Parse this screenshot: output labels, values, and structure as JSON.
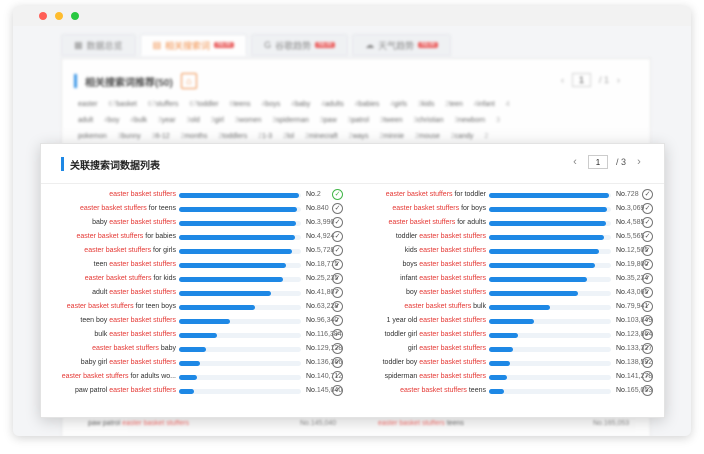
{
  "window": {
    "title": ""
  },
  "background": {
    "tabs": [
      {
        "label": "数据总览",
        "active": false,
        "badge": ""
      },
      {
        "label": "相关搜索词",
        "active": true,
        "badge": "NEW"
      },
      {
        "label": "谷歌趋势",
        "active": false,
        "badge": "NEW"
      },
      {
        "label": "天气趋势",
        "active": false,
        "badge": "NEW"
      }
    ],
    "card_title": "相关搜索词推荐(50)",
    "pager": {
      "page": "1",
      "total": "/ 1"
    },
    "keyword_rows": [
      [
        [
          "easter",
          "67"
        ],
        [
          "basket",
          "67"
        ],
        [
          "stuffers",
          "67"
        ],
        [
          "toddler",
          "6"
        ],
        [
          "teens",
          "4"
        ],
        [
          "boys",
          "4"
        ],
        [
          "baby",
          "4"
        ],
        [
          "adults",
          "4"
        ],
        [
          "babies",
          "4"
        ],
        [
          "girls",
          "3"
        ],
        [
          "kids",
          "2"
        ],
        [
          "teen",
          "4"
        ],
        [
          "infant",
          "4"
        ]
      ],
      [
        [
          "adult",
          "4"
        ],
        [
          "boy",
          "4"
        ],
        [
          "bulk",
          "3"
        ],
        [
          "year",
          "3"
        ],
        [
          "old",
          "3"
        ],
        [
          "girl",
          "3"
        ],
        [
          "women",
          "3"
        ],
        [
          "spiderman",
          "3"
        ],
        [
          "paw",
          "3"
        ],
        [
          "patrol",
          "3"
        ],
        [
          "tween",
          "3"
        ],
        [
          "christian",
          "3"
        ],
        [
          "newborn",
          "3"
        ]
      ],
      [
        [
          "pokemon",
          "3"
        ],
        [
          "bunny",
          "3"
        ],
        [
          "6-12",
          "2"
        ],
        [
          "months",
          "2"
        ],
        [
          "toddlers",
          "2"
        ],
        [
          "1-3",
          "2"
        ],
        [
          "lol",
          "2"
        ],
        [
          "minecraft",
          "2"
        ],
        [
          "ways",
          "2"
        ],
        [
          "minnie",
          "2"
        ],
        [
          "mouse",
          "2"
        ],
        [
          "candy",
          "2"
        ]
      ]
    ]
  },
  "panel": {
    "title": "关联搜索词数据列表",
    "pager": {
      "prev": "‹",
      "page": "1",
      "total": "/ 3",
      "next": "›"
    },
    "left": [
      {
        "pre": "",
        "hl": "easter basket stuffers",
        "post": "",
        "rank": "No.",
        "num": "2",
        "fill": 0.98,
        "checked": true
      },
      {
        "pre": "",
        "hl": "easter basket stuffers",
        "post": " for teens",
        "rank": "No.",
        "num": "840",
        "fill": 0.97,
        "checked": false
      },
      {
        "pre": "baby ",
        "hl": "easter basket stuffers",
        "post": "",
        "rank": "No.",
        "num": "3,990",
        "fill": 0.96,
        "checked": false
      },
      {
        "pre": "",
        "hl": "easter basket stuffers",
        "post": " for babies",
        "rank": "No.",
        "num": "4,924",
        "fill": 0.95,
        "checked": false
      },
      {
        "pre": "",
        "hl": "easter basket stuffers",
        "post": " for girls",
        "rank": "No.",
        "num": "5,728",
        "fill": 0.93,
        "checked": false
      },
      {
        "pre": "teen ",
        "hl": "easter basket stuffers",
        "post": "",
        "rank": "No.",
        "num": "18,775",
        "fill": 0.88,
        "checked": false
      },
      {
        "pre": "",
        "hl": "easter basket stuffers",
        "post": " for kids",
        "rank": "No.",
        "num": "25,235",
        "fill": 0.85,
        "checked": false
      },
      {
        "pre": "adult ",
        "hl": "easter basket stuffers",
        "post": "",
        "rank": "No.",
        "num": "41,807",
        "fill": 0.75,
        "checked": false
      },
      {
        "pre": "",
        "hl": "easter basket stuffers",
        "post": " for teen boys",
        "rank": "No.",
        "num": "63,228",
        "fill": 0.62,
        "checked": false
      },
      {
        "pre": "teen boy ",
        "hl": "easter basket stuffers",
        "post": "",
        "rank": "No.",
        "num": "96,340",
        "fill": 0.42,
        "checked": false
      },
      {
        "pre": "bulk ",
        "hl": "easter basket stuffers",
        "post": "",
        "rank": "No.",
        "num": "116,384",
        "fill": 0.31,
        "checked": false
      },
      {
        "pre": "",
        "hl": "easter basket stuffers",
        "post": " baby",
        "rank": "No.",
        "num": "129,128",
        "fill": 0.22,
        "checked": false
      },
      {
        "pre": "baby girl ",
        "hl": "easter basket stuffers",
        "post": "",
        "rank": "No.",
        "num": "136,366",
        "fill": 0.17,
        "checked": false
      },
      {
        "pre": "",
        "hl": "easter basket stuffers",
        "post": " for adults wo...",
        "rank": "No.",
        "num": "140,712",
        "fill": 0.15,
        "checked": false
      },
      {
        "pre": "paw patrol ",
        "hl": "easter basket stuffers",
        "post": "",
        "rank": "No.",
        "num": "145,040",
        "fill": 0.12,
        "checked": false
      }
    ],
    "right": [
      {
        "pre": "",
        "hl": "easter basket stuffers",
        "post": " for toddler",
        "rank": "No.",
        "num": "728",
        "fill": 0.98,
        "checked": false
      },
      {
        "pre": "",
        "hl": "easter basket stuffers",
        "post": " for boys",
        "rank": "No.",
        "num": "3,069",
        "fill": 0.97,
        "checked": false
      },
      {
        "pre": "",
        "hl": "easter basket stuffers",
        "post": " for adults",
        "rank": "No.",
        "num": "4,585",
        "fill": 0.96,
        "checked": false
      },
      {
        "pre": "toddler ",
        "hl": "easter basket stuffers",
        "post": "",
        "rank": "No.",
        "num": "5,565",
        "fill": 0.94,
        "checked": false
      },
      {
        "pre": "kids ",
        "hl": "easter basket stuffers",
        "post": "",
        "rank": "No.",
        "num": "12,505",
        "fill": 0.9,
        "checked": false
      },
      {
        "pre": "boys ",
        "hl": "easter basket stuffers",
        "post": "",
        "rank": "No.",
        "num": "19,800",
        "fill": 0.87,
        "checked": false
      },
      {
        "pre": "infant ",
        "hl": "easter basket stuffers",
        "post": "",
        "rank": "No.",
        "num": "35,234",
        "fill": 0.8,
        "checked": false
      },
      {
        "pre": "boy ",
        "hl": "easter basket stuffers",
        "post": "",
        "rank": "No.",
        "num": "43,065",
        "fill": 0.73,
        "checked": false
      },
      {
        "pre": "",
        "hl": "easter basket stuffers",
        "post": " bulk",
        "rank": "No.",
        "num": "79,941",
        "fill": 0.5,
        "checked": false
      },
      {
        "pre": "1 year old ",
        "hl": "easter basket stuffers",
        "post": "",
        "rank": "No.",
        "num": "103,849",
        "fill": 0.37,
        "checked": false
      },
      {
        "pre": "toddler girl ",
        "hl": "easter basket stuffers",
        "post": "",
        "rank": "No.",
        "num": "123,864",
        "fill": 0.24,
        "checked": false
      },
      {
        "pre": "girl ",
        "hl": "easter basket stuffers",
        "post": "",
        "rank": "No.",
        "num": "133,327",
        "fill": 0.2,
        "checked": false
      },
      {
        "pre": "toddler boy ",
        "hl": "easter basket stuffers",
        "post": "",
        "rank": "No.",
        "num": "138,592",
        "fill": 0.17,
        "checked": false
      },
      {
        "pre": "spiderman ",
        "hl": "easter basket stuffers",
        "post": "",
        "rank": "No.",
        "num": "141,278",
        "fill": 0.15,
        "checked": false
      },
      {
        "pre": "",
        "hl": "easter basket stuffers",
        "post": " teens",
        "rank": "No.",
        "num": "165,053",
        "fill": 0.12,
        "checked": false
      }
    ]
  },
  "bottom_peek": {
    "left": {
      "pre": "paw patrol ",
      "hl": "easter basket stuffers",
      "num": "No.145,040"
    },
    "right": {
      "pre": "",
      "hl": "easter basket stuffers",
      "post": " teens",
      "num": "No.165,053"
    }
  },
  "colors": {
    "accent": "#1e88e5",
    "highlight": "#e53935",
    "active_tab": "#f07c2a",
    "check_on": "#43b649"
  }
}
